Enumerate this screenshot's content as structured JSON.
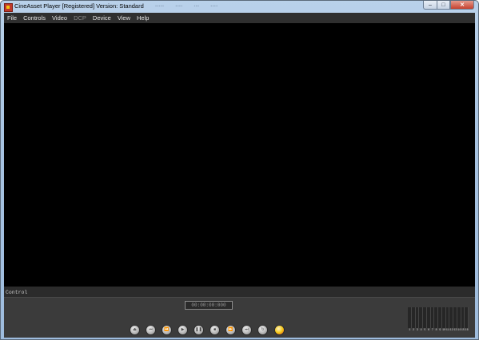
{
  "window": {
    "title": "CineAsset Player [Registered] Version: Standard",
    "close_glyph": "✕",
    "minimize_glyph": "–",
    "maximize_glyph": "□"
  },
  "menu": [
    {
      "label": "File",
      "enabled": true
    },
    {
      "label": "Controls",
      "enabled": true
    },
    {
      "label": "Video",
      "enabled": true
    },
    {
      "label": "DCP",
      "enabled": false
    },
    {
      "label": "Device",
      "enabled": true
    },
    {
      "label": "View",
      "enabled": true
    },
    {
      "label": "Help",
      "enabled": true
    }
  ],
  "control_panel": {
    "label": "Control",
    "timecode": "00:00:00:000"
  },
  "transport_buttons": [
    {
      "name": "eject-button",
      "icon": "eject-icon",
      "glyph": "⏏"
    },
    {
      "name": "previous-button",
      "icon": "skip-back-icon",
      "glyph": "⏮"
    },
    {
      "name": "rewind-button",
      "icon": "rewind-icon",
      "glyph": "⏪"
    },
    {
      "name": "play-button",
      "icon": "play-icon",
      "glyph": "▶"
    },
    {
      "name": "pause-button",
      "icon": "pause-icon",
      "glyph": "❚❚"
    },
    {
      "name": "stop-button",
      "icon": "stop-icon",
      "glyph": "■"
    },
    {
      "name": "fast-forward-button",
      "icon": "fast-forward-icon",
      "glyph": "⏩"
    },
    {
      "name": "next-button",
      "icon": "skip-forward-icon",
      "glyph": "⏭"
    },
    {
      "name": "loop-button",
      "icon": "loop-icon",
      "glyph": "↻"
    },
    {
      "name": "color-button",
      "icon": "color-wheel-icon",
      "glyph": ""
    }
  ],
  "audio_meter": {
    "channels": [
      "1",
      "2",
      "3",
      "4",
      "5",
      "6",
      "7",
      "8",
      "9",
      "10",
      "11",
      "12",
      "13",
      "14",
      "15",
      "16"
    ]
  },
  "colors": {
    "video_background": "#000000",
    "panel_background": "#3b3b3b",
    "menu_text": "#e6e6e6"
  }
}
